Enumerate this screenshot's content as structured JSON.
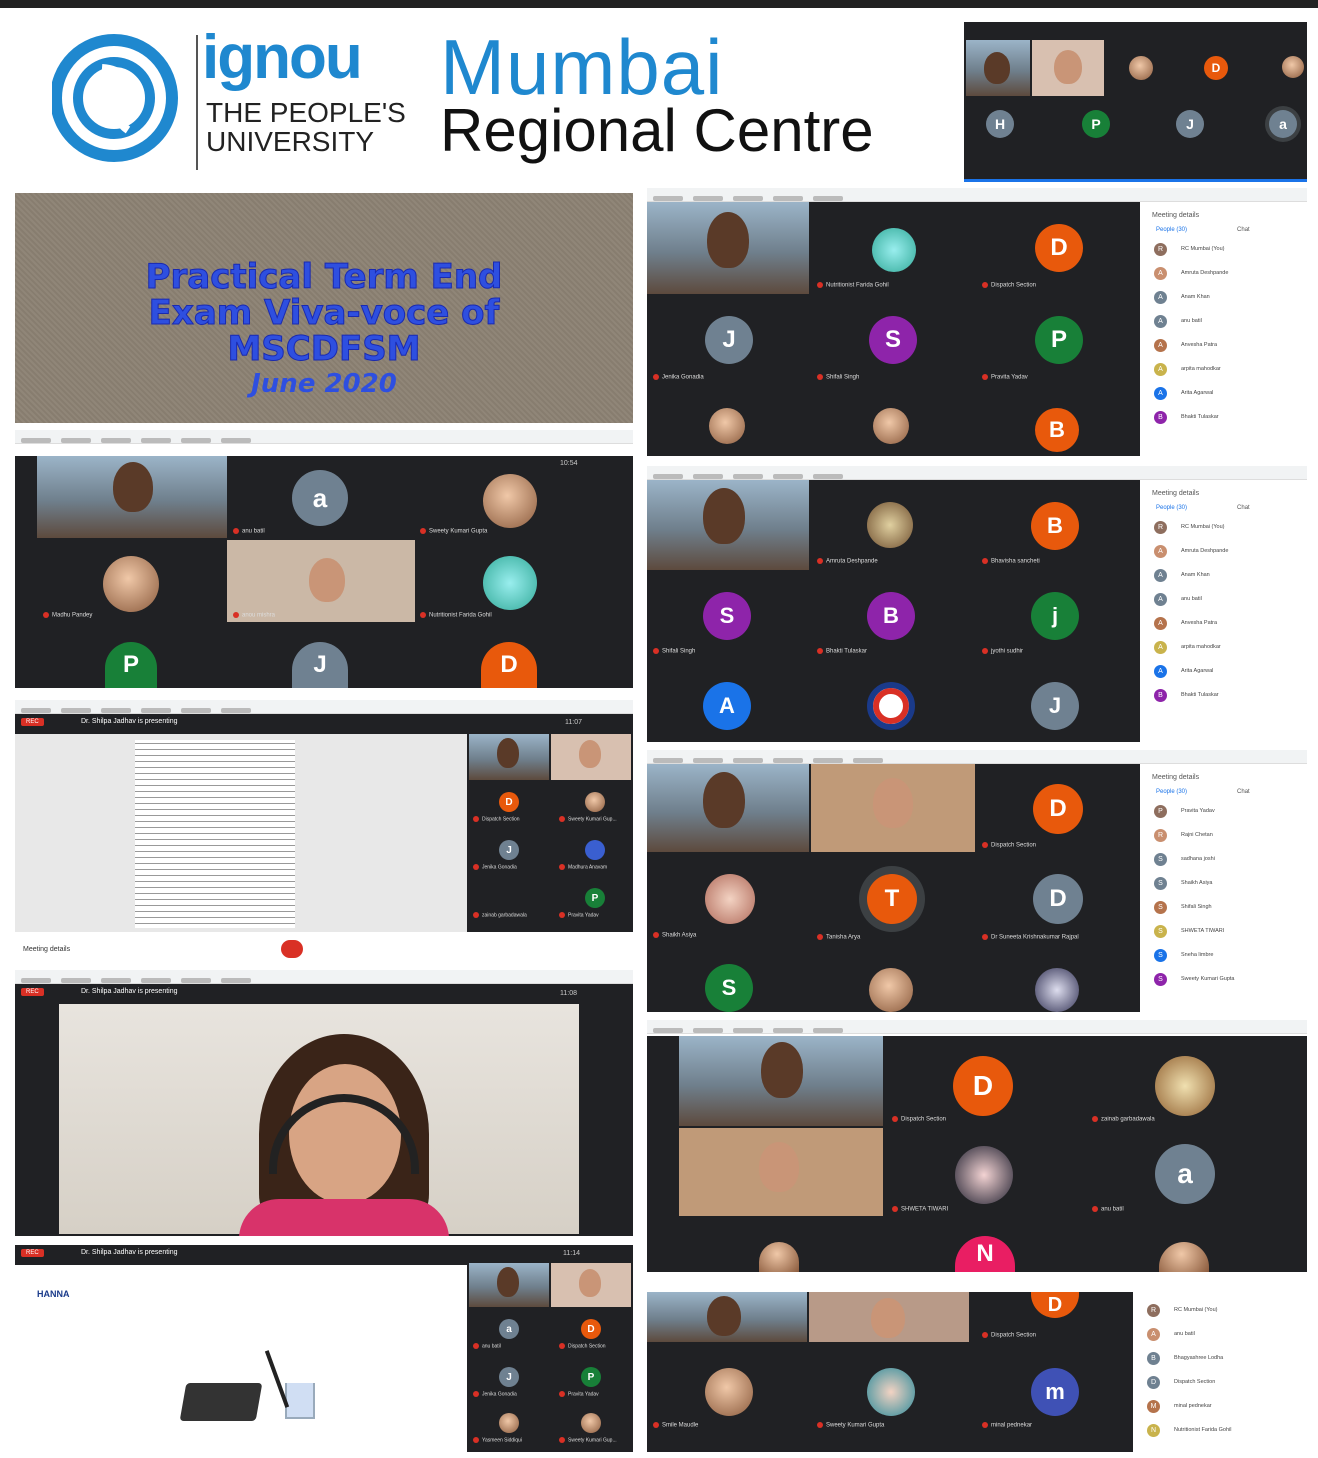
{
  "header": {
    "brand": "ignou",
    "tagline1": "THE PEOPLE'S",
    "tagline2": "UNIVERSITY",
    "centre_line1": "Mumbai",
    "centre_line2": "Regional Centre"
  },
  "banner": {
    "line1": "Practical Term End",
    "line2": "Exam Viva-voce of",
    "line3": "MSCDFSM",
    "line4": "June 2020"
  },
  "meet": {
    "meeting_details": "Meeting details",
    "people_tab": "People (30)",
    "chat_tab": "Chat",
    "rec": "REC",
    "presenting": "Dr. Shilpa Jadhav is presenting",
    "time1": "10:54",
    "time2": "11:07",
    "time3": "11:08",
    "time4": "11:14"
  },
  "colors": {
    "accent": "#1f88cf",
    "banner_text": "#2e4fe0",
    "meet_bg": "#202124",
    "orange": "#e8590c",
    "purple": "#8e24aa",
    "green": "#188038",
    "blue": "#1a73e8",
    "grey": "#6f8191"
  },
  "shot_a": {
    "tiles": [
      {
        "letter": "D",
        "color": "#e8590c",
        "name": "Dispatch Section"
      },
      {
        "letter": "J",
        "color": "#6f8191",
        "name": "Jenika Gonadia"
      },
      {
        "letter": "S",
        "color": "#8e24aa",
        "name": "Shifali Singh"
      },
      {
        "letter": "P",
        "color": "#188038",
        "name": "Pravita Yadav"
      },
      {
        "letter": "B",
        "color": "#e8590c",
        "name": ""
      }
    ],
    "people": [
      "RC Mumbai (You)",
      "Amruta Deshpande",
      "Anam Khan",
      "anu batil",
      "Anvesha Patra",
      "arpita mahodkar",
      "Arita Agarwal",
      "Bhakti Tulaskar"
    ]
  },
  "shot_b": {
    "tiles": [
      {
        "letter": "a",
        "color": "#6f8191",
        "name": "anu batil"
      },
      {
        "letter": "P",
        "color": "#188038",
        "name": ""
      },
      {
        "letter": "J",
        "color": "#6f8191",
        "name": ""
      },
      {
        "letter": "D",
        "color": "#e8590c",
        "name": ""
      }
    ],
    "names": [
      "Madhu Pandey",
      "anou mishra",
      "Nutritionist Farida Gohil",
      "Sweety Kumari Gupta"
    ]
  },
  "shot_c": {
    "tiles": [
      {
        "letter": "B",
        "color": "#e8590c",
        "name": "Bhavisha sancheti"
      },
      {
        "letter": "S",
        "color": "#8e24aa",
        "name": "Shifali Singh"
      },
      {
        "letter": "B",
        "color": "#8e24aa",
        "name": "Bhakti Tulaskar"
      },
      {
        "letter": "j",
        "color": "#188038",
        "name": "jyothi sudhir"
      },
      {
        "letter": "A",
        "color": "#1a73e8",
        "name": ""
      },
      {
        "letter": "J",
        "color": "#6f8191",
        "name": ""
      }
    ],
    "names": [
      "Amruta Deshpande"
    ]
  },
  "shot_d": {
    "tiles": [
      {
        "letter": "D",
        "color": "#e8590c",
        "name": "Dispatch Section"
      },
      {
        "letter": "T",
        "color": "#e8590c",
        "name": "Tanisha Arya"
      },
      {
        "letter": "D",
        "color": "#6f8191",
        "name": "Dr Suneeta Krishnakumar Rajpal"
      },
      {
        "letter": "S",
        "color": "#188038",
        "name": ""
      }
    ],
    "names": [
      "Shaikh Asiya"
    ],
    "people": [
      "Pravita Yadav",
      "Rajni Chetan",
      "sadhana joshi",
      "Shaikh Asiya",
      "Shifali Singh",
      "SHWETA TIWARI",
      "Sneha limbre",
      "Sweety Kumari Gupta"
    ]
  },
  "shot_e": {
    "tiles": [
      {
        "letter": "D",
        "color": "#e8590c",
        "name": "Dispatch Section"
      },
      {
        "letter": "a",
        "color": "#6f8191",
        "name": "anu batil"
      },
      {
        "letter": "N",
        "color": "#e91e63",
        "name": ""
      }
    ],
    "names": [
      "zainab garbadawala",
      "SHWETA TIWARI"
    ]
  },
  "shot_f": {
    "tiles": [
      {
        "letter": "D",
        "color": "#e8590c",
        "name": "Dispatch Section"
      },
      {
        "letter": "m",
        "color": "#3f51b5",
        "name": "minal pednekar"
      }
    ],
    "names": [
      "Smile Maudle",
      "Sweety Kumari Gupta"
    ],
    "people": [
      "RC Mumbai (You)",
      "anu batil",
      "Bhagyashree Lodha",
      "Dispatch Section",
      "minal pednekar",
      "Nutritionist Farida Gohil"
    ]
  },
  "shot_g": {
    "tiles": [
      {
        "letter": "D",
        "color": "#e8590c",
        "name": "Dispatch Section"
      },
      {
        "letter": "J",
        "color": "#6f8191",
        "name": "Jenika Gonadia"
      },
      {
        "letter": "P",
        "color": "#188038",
        "name": "Pravita Yadav"
      }
    ],
    "names": [
      "Sweety Kumari Gup...",
      "Madhura Anavam",
      "zainab garbadawala"
    ]
  },
  "shot_h": {
    "tiles": [
      {
        "letter": "a",
        "color": "#6f8191",
        "name": "anu batil"
      },
      {
        "letter": "D",
        "color": "#e8590c",
        "name": "Dispatch Section"
      },
      {
        "letter": "J",
        "color": "#6f8191",
        "name": "Jenika Gonadia"
      },
      {
        "letter": "P",
        "color": "#188038",
        "name": "Pravita Yadav"
      }
    ],
    "names": [
      "Yasmeen Siddiqui",
      "Sweety Kumari Gup..."
    ],
    "site": "HANNA"
  },
  "shot_top": {
    "tiles": [
      {
        "letter": "D",
        "color": "#e8590c"
      },
      {
        "letter": "H",
        "color": "#6f8191"
      },
      {
        "letter": "P",
        "color": "#188038"
      },
      {
        "letter": "J",
        "color": "#6f8191"
      },
      {
        "letter": "a",
        "color": "#6f8191"
      }
    ]
  }
}
